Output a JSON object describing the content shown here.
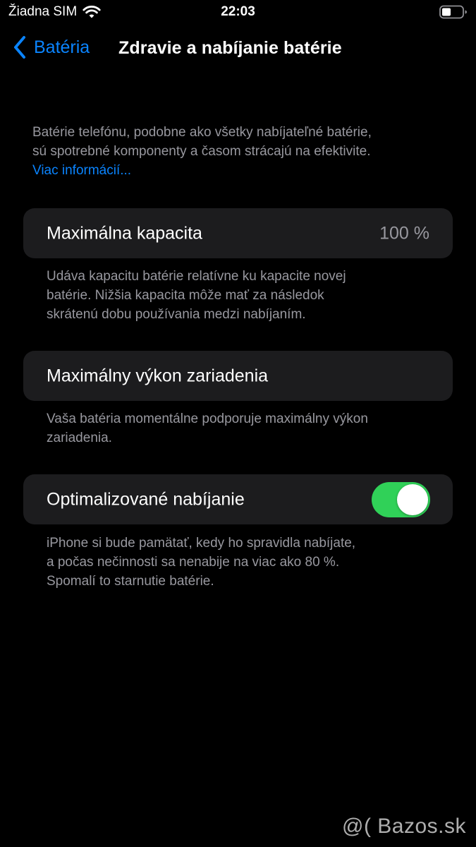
{
  "status_bar": {
    "carrier": "Žiadna SIM",
    "time": "22:03",
    "icons": [
      "wifi-icon",
      "battery-icon"
    ]
  },
  "nav": {
    "back_label": "Batéria",
    "title": "Zdravie a nabíjanie batérie"
  },
  "intro": {
    "lines": [
      "Batérie telefónu, podobne ako všetky nabíjateľné batérie,",
      "sú spotrebné komponenty a časom strácajú na efektivite."
    ],
    "link": "Viac informácií..."
  },
  "sections": {
    "capacity": {
      "label": "Maximálna kapacita",
      "value": "100 %",
      "footer": [
        "Udáva kapacitu batérie relatívne ku kapacite novej",
        "batérie. Nižšia kapacita môže mať za následok",
        "skrátenú dobu používania medzi nabíjaním."
      ]
    },
    "performance": {
      "label": "Maximálny výkon zariadenia",
      "footer": [
        "Vaša batéria momentálne podporuje maximálny výkon",
        "zariadenia."
      ]
    },
    "optimized": {
      "label": "Optimalizované nabíjanie",
      "toggle_on": true,
      "footer": [
        "iPhone si bude pamätať, kedy ho spravidla nabíjate,",
        "a počas nečinnosti sa nenabije na viac ako 80 %.",
        "Spomalí to starnutie batérie."
      ]
    }
  },
  "watermark": "@( Bazos.sk",
  "colors": {
    "accent": "#0a84ff",
    "toggle_on": "#30d158",
    "cell_bg": "#1c1c1e",
    "secondary_text": "#98989f"
  }
}
